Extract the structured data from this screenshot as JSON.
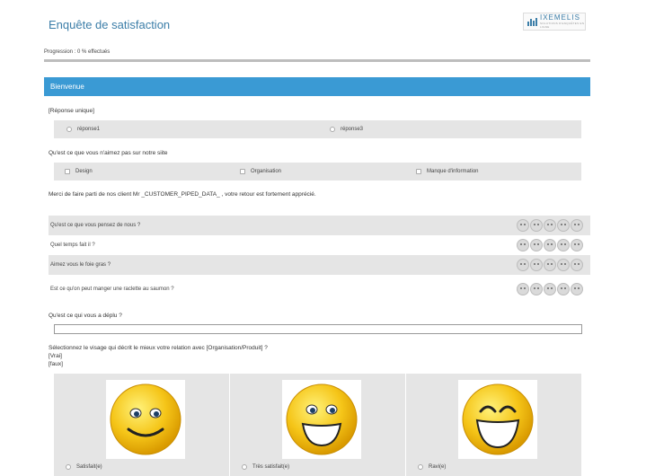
{
  "header": {
    "title": "Enquête de satisfaction",
    "logo_text": "IXEMELIS",
    "logo_subtext": "SOLUTIONS D'ENQUÊTES EN LIGNE"
  },
  "progress": {
    "label": "Progression : 0 % effectués",
    "fraction": 0
  },
  "section": {
    "title": "Bienvenue"
  },
  "q1": {
    "label": "[Réponse unique]",
    "options": [
      "réponse1",
      "réponse3"
    ]
  },
  "q2": {
    "label": "Qu'est ce que vous n'aimez pas sur notre siite",
    "options": [
      "Design",
      "Organisation",
      "Manque d'information"
    ]
  },
  "intro_text": "Merci de faire parti de nos client Mr _CUSTOMER_PIPED_DATA_ , votre retour est fortement apprécié.",
  "matrix": {
    "rows": [
      "Qu'est ce que vous pensez de nous ?",
      "Quel temps fait il ?",
      "Aimez vous le foie gras ?",
      "Est ce qu'on peut manger une raclette au saumon ?"
    ],
    "scale_count": 5
  },
  "q3": {
    "label": "Qu'est ce qui vous a déplu ?",
    "value": ""
  },
  "q4": {
    "label": "Sélectionnez le visage qui décrit le mieux votre relation avec [Organisation/Produit] ?",
    "line2": "[Vrai]",
    "line3": "[faux]",
    "options": [
      "Satisfait(e)",
      "Très satisfait(e)",
      "Ravi(e)"
    ]
  },
  "colors": {
    "accent": "#3a9ad4",
    "title": "#3c7ea8",
    "row_bg": "#e5e5e5",
    "emoji_yellow": "#f5c518"
  }
}
